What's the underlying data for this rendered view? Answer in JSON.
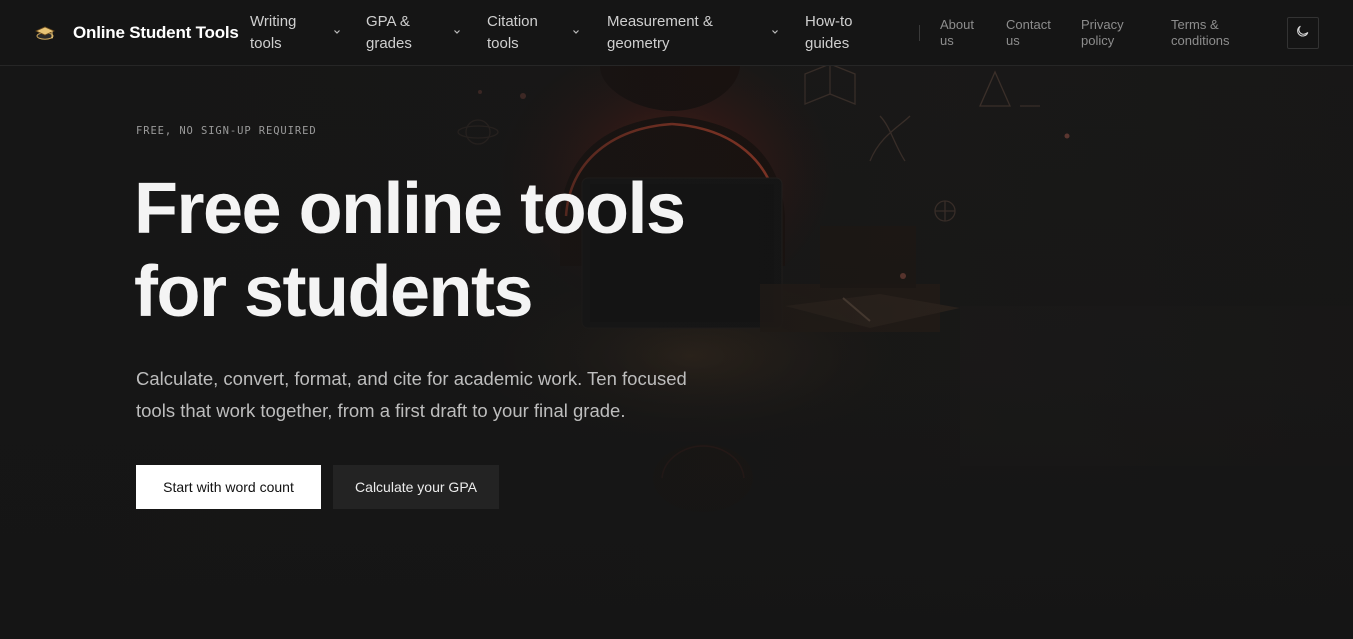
{
  "header": {
    "brand_name": "Online Student Tools",
    "brand_logo_icon": "graduation-cap-logo-icon",
    "nav": [
      {
        "label": "Writing tools",
        "icon": "chevron-down-icon"
      },
      {
        "label": "GPA & grades",
        "icon": "chevron-down-icon"
      },
      {
        "label": "Citation tools",
        "icon": "chevron-down-icon"
      },
      {
        "label": "Measurement & geometry",
        "icon": "chevron-down-icon"
      },
      {
        "label": "How-to guides"
      }
    ],
    "utility_links": [
      "About us",
      "Contact us",
      "Privacy policy",
      "Terms & conditions"
    ],
    "theme_toggle_icon": "moon-icon"
  },
  "hero": {
    "eyebrow": "FREE, NO SIGN-UP REQUIRED",
    "headline": "Free online tools for students",
    "subtitle": "Calculate, convert, format, and cite for academic work. Ten focused tools that work together, from a first draft to your final grade.",
    "primary_button": "Start with word count",
    "secondary_button": "Calculate your GPA",
    "background_image": "student-at-laptop-silhouette-illustration"
  },
  "colors": {
    "page_background": "#141414",
    "header_background": "#151515",
    "primary_button_bg": "#ffffff",
    "secondary_button_bg": "#232323",
    "accent_glow": "#ff3b2a"
  }
}
